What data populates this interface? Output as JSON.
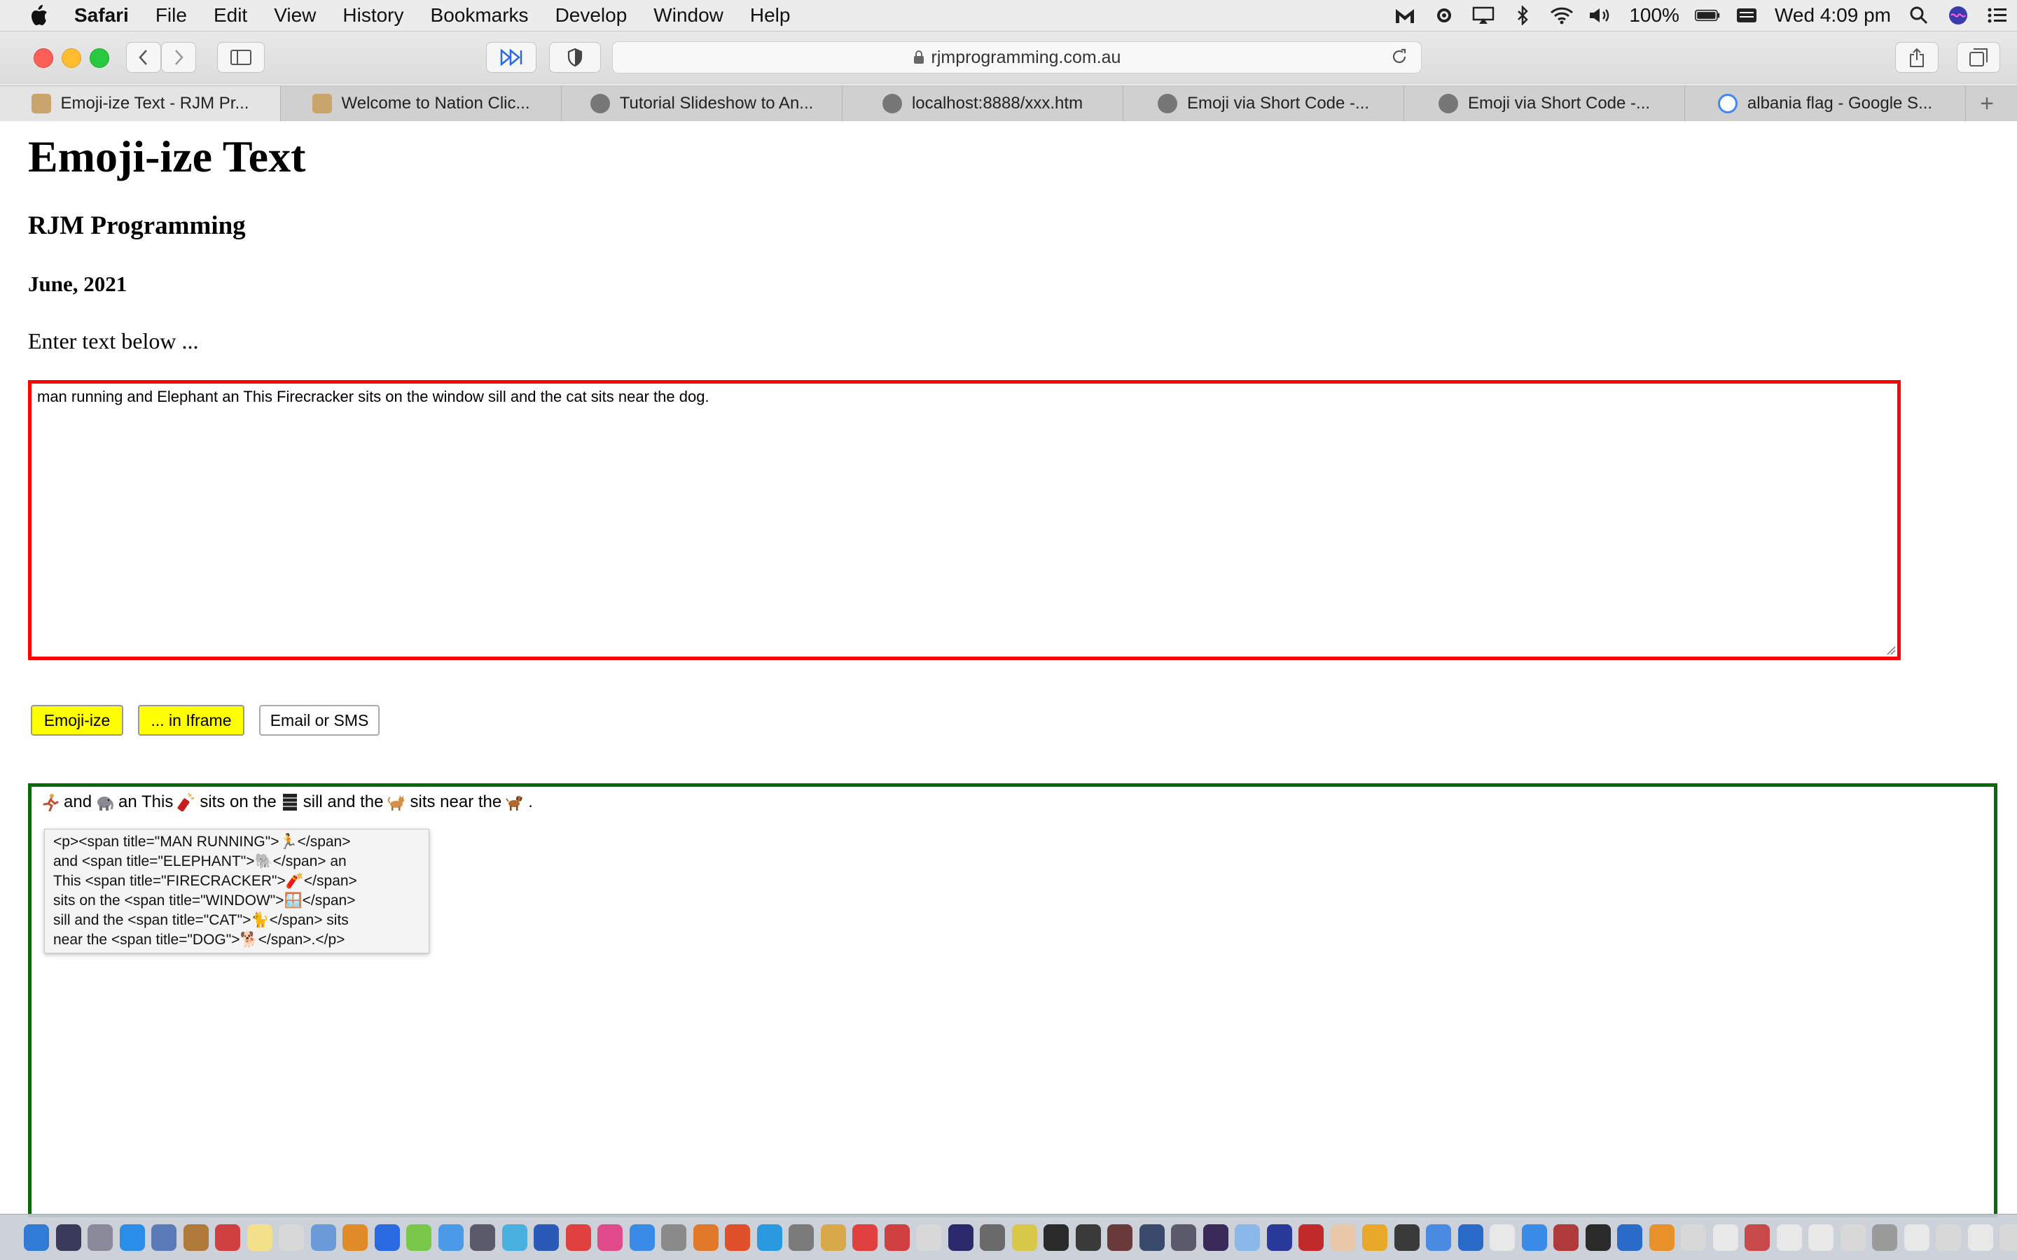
{
  "menubar": {
    "app_name": "Safari",
    "items": [
      "File",
      "Edit",
      "View",
      "History",
      "Bookmarks",
      "Develop",
      "Window",
      "Help"
    ],
    "battery": "100%",
    "clock": "Wed 4:09 pm"
  },
  "toolbar": {
    "url": "rjmprogramming.com.au"
  },
  "tabs": [
    {
      "title": "Emoji-ize Text - RJM Pr...",
      "active": true,
      "favicon_color": "#c9a46b"
    },
    {
      "title": "Welcome to Nation Clic...",
      "active": false,
      "favicon_color": "#c9a46b"
    },
    {
      "title": "Tutorial Slideshow to An...",
      "active": false,
      "favicon_color": "#777777"
    },
    {
      "title": "localhost:8888/xxx.htm",
      "active": false,
      "favicon_color": "#777777"
    },
    {
      "title": "Emoji via Short Code -...",
      "active": false,
      "favicon_color": "#777777"
    },
    {
      "title": "Emoji via Short Code -...",
      "active": false,
      "favicon_color": "#777777"
    },
    {
      "title": "albania flag - Google S...",
      "active": false,
      "favicon_color": "#4285f4"
    }
  ],
  "page": {
    "title": "Emoji-ize Text",
    "author": "RJM Programming",
    "date": "June, 2021",
    "prompt": "Enter text below ...",
    "input_value": "man running and Elephant an This Firecracker sits on the window sill  and the cat sits near the dog.",
    "buttons": {
      "emojize": "Emoji-ize",
      "iframe": "... in Iframe",
      "email_sms": "Email or SMS"
    },
    "output": {
      "segments": [
        {
          "type": "emoji",
          "icon": "man-running-emoji"
        },
        {
          "type": "text",
          "value": "and"
        },
        {
          "type": "emoji",
          "icon": "elephant-emoji"
        },
        {
          "type": "text",
          "value": "an This"
        },
        {
          "type": "emoji",
          "icon": "firecracker-emoji"
        },
        {
          "type": "text",
          "value": "sits on the"
        },
        {
          "type": "emoji",
          "icon": "window-emoji"
        },
        {
          "type": "text",
          "value": "sill  and the"
        },
        {
          "type": "emoji",
          "icon": "cat-emoji"
        },
        {
          "type": "text",
          "value": "sits near the"
        },
        {
          "type": "emoji",
          "icon": "dog-emoji"
        },
        {
          "type": "text",
          "value": "."
        }
      ],
      "tooltip_lines": [
        "<p><span title=\"MAN RUNNING\">🏃</span>",
        "and <span title=\"ELEPHANT\">🐘</span> an",
        "This <span title=\"FIRECRACKER\">🧨</span>",
        "sits on the <span title=\"WINDOW\">🪟</span>",
        "sill  and the <span title=\"CAT\">🐈</span> sits",
        "near the <span title=\"DOG\">🐕</span>.</p>"
      ]
    }
  },
  "colors": {
    "input_border": "#ff0000",
    "output_border": "#0a6a0a",
    "button_yellow": "#ffff00"
  },
  "dock": {
    "icon_colors": [
      "#2f7bd6",
      "#3a3a5a",
      "#8a8a9a",
      "#2a8ee8",
      "#5a7ab8",
      "#b07a3a",
      "#d04040",
      "#f3e08a",
      "#d8d8d8",
      "#6a9ad8",
      "#e08a2a",
      "#2a6ae0",
      "#7ac84a",
      "#4a9ae8",
      "#5a5a6a",
      "#4ab0e0",
      "#2a5ab8",
      "#e04040",
      "#e04a8a",
      "#3a8ae8",
      "#8a8a8a",
      "#e07a2a",
      "#e0502a",
      "#2a9ae0",
      "#7a7a7a",
      "#d8a84a",
      "#e04040",
      "#d04040",
      "#d8d8d8",
      "#2a2a6a",
      "#6a6a6a",
      "#d8c84a",
      "#2a2a2a",
      "#3a3a3a",
      "#6a3a3a",
      "#3a4a6a",
      "#5a5a6a",
      "#3a2a5a",
      "#8ab8e8",
      "#2a3a9a",
      "#c02a2a",
      "#e8c8a8",
      "#e8a82a",
      "#3a3a3a",
      "#4a8ae0",
      "#2a6ac8",
      "#e8e8e8",
      "#3a8ae8",
      "#b03a3a",
      "#2a2a2a",
      "#2a6ac8",
      "#e8902a",
      "#d8d8d8",
      "#e8e8e8",
      "#c84a4a",
      "#e8e8e8",
      "#e8e8e8",
      "#d8d8d8",
      "#9a9a9a",
      "#e8e8e8",
      "#d8d8d8",
      "#e8e8e8",
      "#d8d8d8",
      "#9a9a9a"
    ]
  }
}
